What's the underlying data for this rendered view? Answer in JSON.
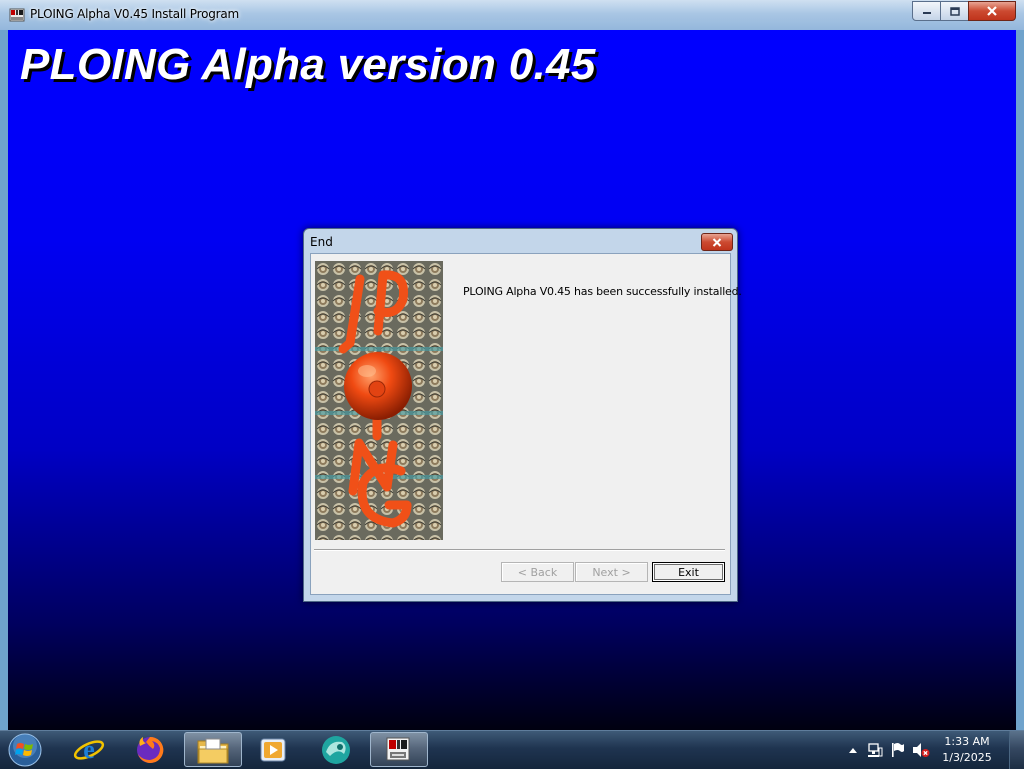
{
  "window": {
    "title": "PLOING Alpha V0.45 Install Program",
    "heading": "PLOING Alpha version 0.45"
  },
  "dialog": {
    "title": "End",
    "message": "PLOING Alpha V0.45 has been successfully installed.",
    "image_letters": "PLOING",
    "buttons": {
      "back": "< Back",
      "next": "Next >",
      "exit": "Exit"
    }
  },
  "taskbar": {
    "items": [
      {
        "name": "start-button",
        "icon": "windows-orb-icon"
      },
      {
        "name": "internet-explorer",
        "icon": "internet-explorer-icon"
      },
      {
        "name": "firefox",
        "icon": "firefox-icon"
      },
      {
        "name": "file-explorer",
        "icon": "folder-icon"
      },
      {
        "name": "media-player",
        "icon": "media-player-icon"
      },
      {
        "name": "app-teal",
        "icon": "teal-app-icon"
      },
      {
        "name": "installer",
        "icon": "installer-icon"
      }
    ],
    "tray": {
      "time": "1:33 AM",
      "date": "1/3/2025"
    }
  },
  "colors": {
    "window_gradient_top": "#0000ff",
    "window_gradient_bottom": "#000010",
    "close_button": "#c84127",
    "titlebar": "#a9c6e4"
  }
}
